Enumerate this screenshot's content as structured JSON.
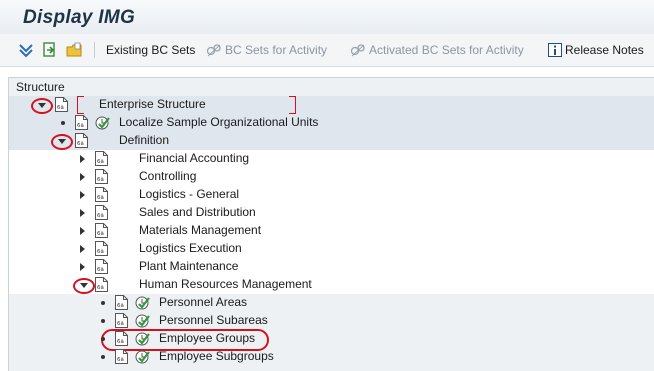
{
  "window": {
    "title": "Display IMG"
  },
  "toolbar": {
    "existing_bc_sets": "Existing BC Sets",
    "bc_sets_for_activity": "BC Sets for Activity",
    "activated_bc_sets_for_activity": "Activated BC Sets for Activity",
    "release_notes": "Release Notes"
  },
  "structure": {
    "header": "Structure",
    "items": [
      {
        "label": "Enterprise Structure",
        "state": "expanded"
      },
      {
        "label": "Localize Sample Organizational Units",
        "state": "leaf"
      },
      {
        "label": "Definition",
        "state": "expanded"
      },
      {
        "label": "Financial Accounting",
        "state": "collapsed"
      },
      {
        "label": "Controlling",
        "state": "collapsed"
      },
      {
        "label": "Logistics - General",
        "state": "collapsed"
      },
      {
        "label": "Sales and Distribution",
        "state": "collapsed"
      },
      {
        "label": "Materials Management",
        "state": "collapsed"
      },
      {
        "label": "Logistics Execution",
        "state": "collapsed"
      },
      {
        "label": "Plant Maintenance",
        "state": "collapsed"
      },
      {
        "label": "Human Resources Management",
        "state": "expanded"
      },
      {
        "label": "Personnel Areas",
        "state": "leaf"
      },
      {
        "label": "Personnel Subareas",
        "state": "leaf"
      },
      {
        "label": "Employee Groups",
        "state": "leaf",
        "highlighted": true
      },
      {
        "label": "Employee Subgroups",
        "state": "leaf"
      }
    ]
  },
  "colors": {
    "highlight": "#d6101f",
    "activity_clock": "#2e9a3c",
    "title": "#1e3346"
  },
  "icons": {
    "customizing_document": "document-icon",
    "execute_activity": "clock-check-icon",
    "release_notes": "info-icon"
  }
}
